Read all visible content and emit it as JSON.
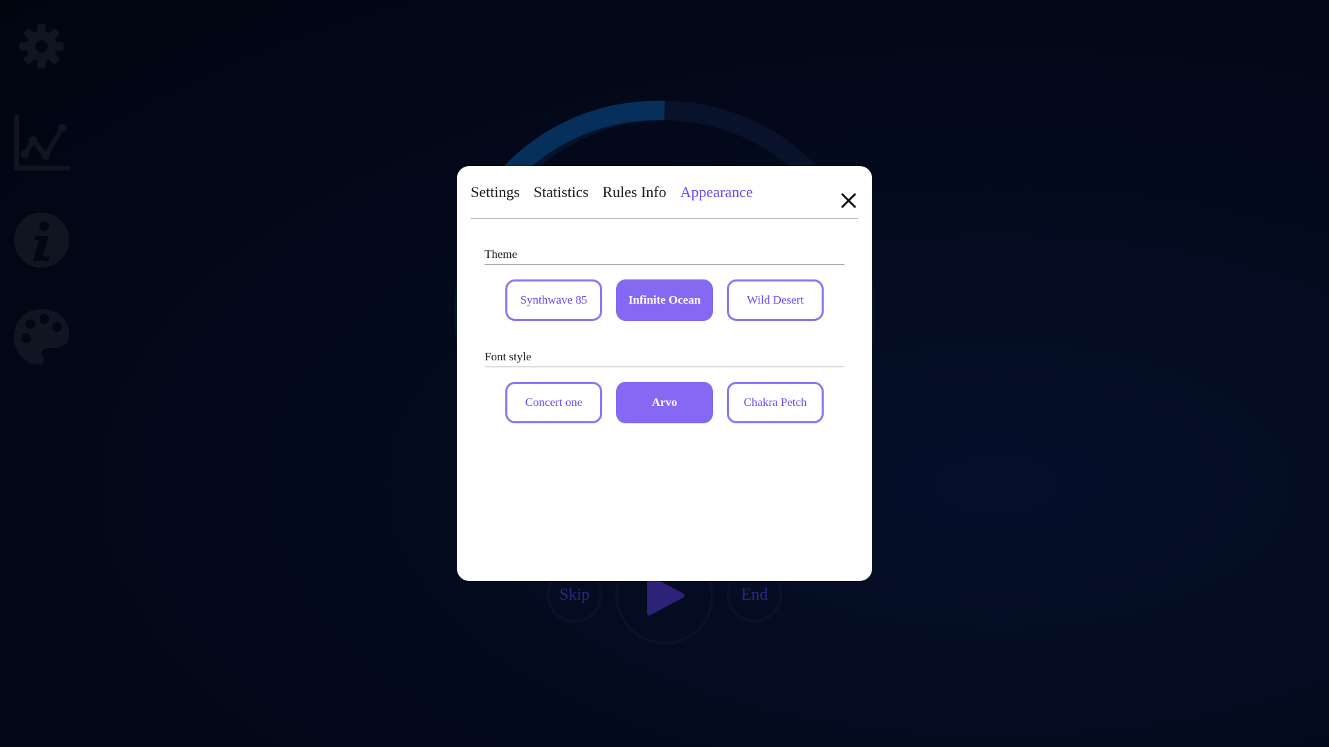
{
  "sidebar": {
    "items": [
      {
        "icon": "gear-icon"
      },
      {
        "icon": "chart-icon"
      },
      {
        "icon": "info-icon"
      },
      {
        "icon": "palette-icon"
      }
    ]
  },
  "controls": {
    "skip_label": "Skip",
    "end_label": "End",
    "play_icon": "play-icon"
  },
  "modal": {
    "tabs": [
      {
        "label": "Settings",
        "active": false
      },
      {
        "label": "Statistics",
        "active": false
      },
      {
        "label": "Rules Info",
        "active": false
      },
      {
        "label": "Appearance",
        "active": true
      }
    ],
    "close_icon": "close-icon",
    "theme": {
      "label": "Theme",
      "options": [
        "Synthwave 85",
        "Infinite Ocean",
        "Wild Desert"
      ],
      "selected": "Infinite Ocean"
    },
    "font_style": {
      "label": "Font style",
      "options": [
        "Concert one",
        "Arvo",
        "Chakra Petch"
      ],
      "selected": "Arvo"
    }
  },
  "colors": {
    "accent": "#8569f3",
    "accent_text": "#6b4bf2",
    "background": "#030a1e",
    "timer_ring": "#0a3f7a"
  }
}
